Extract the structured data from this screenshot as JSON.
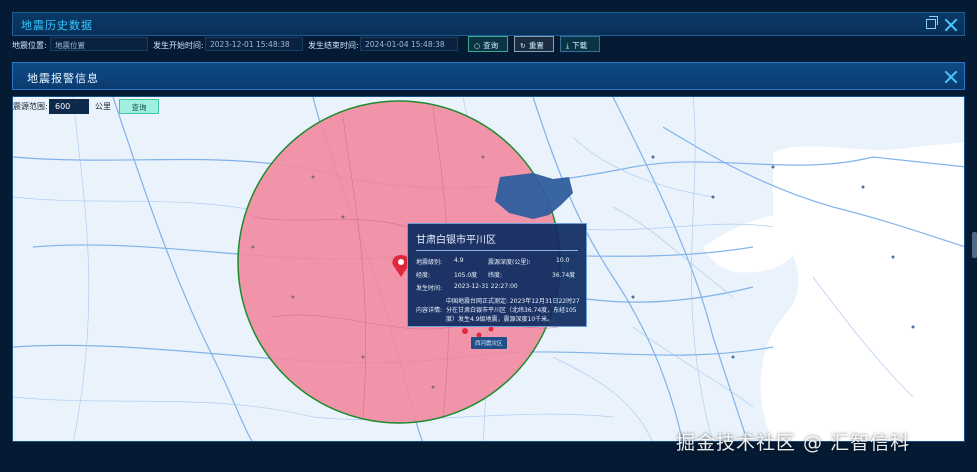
{
  "history_panel": {
    "title": "地震历史数据",
    "filters": {
      "location_label": "地震位置:",
      "location_placeholder": "地震位置",
      "start_label": "发生开始时间:",
      "start_value": "2023-12-01 15:48:38",
      "end_label": "发生结束时间:",
      "end_value": "2024-01-04 15:48:38"
    },
    "buttons": {
      "query": "查询",
      "reset": "重置",
      "download": "下载"
    }
  },
  "alert_dialog": {
    "title": "地震报警信息",
    "range": {
      "label": "震源范围:",
      "value": "600",
      "unit": "公里",
      "query": "查询"
    },
    "popup": {
      "title": "甘肃白银市平川区",
      "magnitude_label": "地震级别:",
      "magnitude_value": "4.9",
      "depth_label": "震源深度(公里):",
      "depth_value": "10.0",
      "longitude_label": "经度:",
      "longitude_value": "105.0度",
      "latitude_label": "纬度:",
      "latitude_value": "36.74度",
      "time_label": "发生时间:",
      "time_value": "2023-12-31 22:27:00",
      "source_line": "中国地震台网正式测定: 2023年12月31日22时27",
      "detail_label": "内容详情:",
      "detail_text": "分在甘肃白银市平川区（北纬36.74度，东经105度）发生4.9级地震，震源深度10千米。"
    },
    "map_tag": "西河震灾区"
  },
  "watermark": "掘金技术社区 @ 汇智信科",
  "colors": {
    "accent": "#35c6ff",
    "circle_fill": "#f28aa0",
    "circle_stroke": "#1e8b2c",
    "marker": "#e0283c"
  }
}
